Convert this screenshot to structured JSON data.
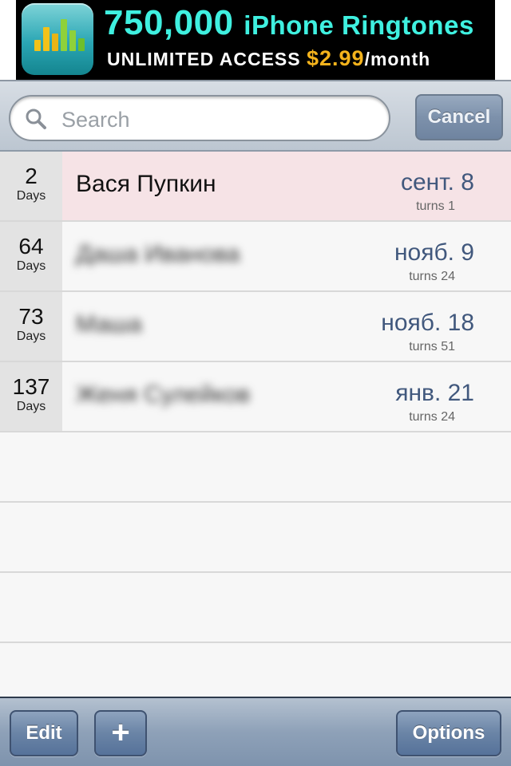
{
  "ad": {
    "headline_number": "750,000",
    "headline_rest": "iPhone Ringtones",
    "subline": "UNLIMITED ACCESS",
    "price": "$2.99",
    "per": "/month"
  },
  "search": {
    "placeholder": "Search",
    "cancel_label": "Cancel"
  },
  "rows": [
    {
      "days": "2",
      "days_label": "Days",
      "name": "Вася Пупкин",
      "date": "сент. 8",
      "turns": "turns 1",
      "highlight": true,
      "blurred": false
    },
    {
      "days": "64",
      "days_label": "Days",
      "name": "Даша Иванова",
      "date": "нояб. 9",
      "turns": "turns 24",
      "highlight": false,
      "blurred": true
    },
    {
      "days": "73",
      "days_label": "Days",
      "name": "Маша",
      "date": "нояб. 18",
      "turns": "turns 51",
      "highlight": false,
      "blurred": true
    },
    {
      "days": "137",
      "days_label": "Days",
      "name": "Женя Сулейков",
      "date": "янв. 21",
      "turns": "turns 24",
      "highlight": false,
      "blurred": true
    }
  ],
  "toolbar": {
    "edit_label": "Edit",
    "add_label": "+",
    "options_label": "Options"
  },
  "colors": {
    "date_text": "#41587d",
    "highlight_row": "#f6e3e6",
    "ad_headline": "#3ff0e0",
    "ad_price": "#f4b31c"
  },
  "icons": [
    "app-icon",
    "search-icon",
    "plus-icon"
  ]
}
